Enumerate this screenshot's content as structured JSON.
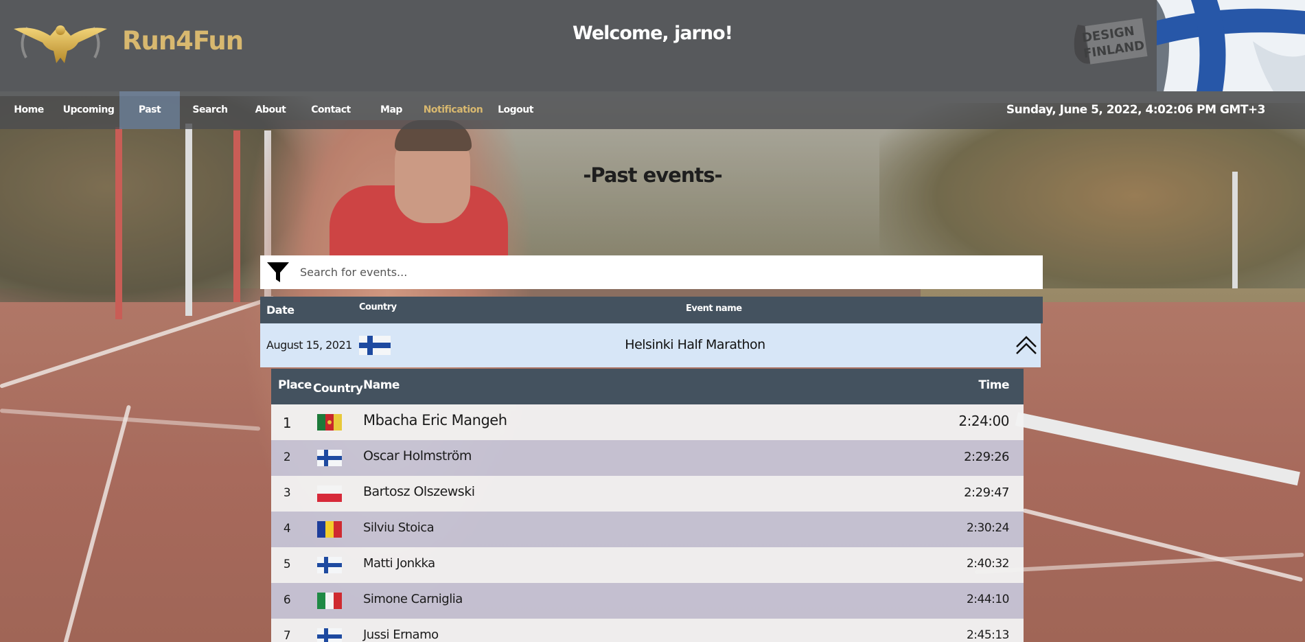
{
  "header": {
    "brand": "Run4Fun",
    "welcome": "Welcome, jarno!",
    "badge_line1": "DESIGN",
    "badge_line2": "FINLAND"
  },
  "nav": {
    "items": [
      {
        "label": "Home"
      },
      {
        "label": "Upcoming"
      },
      {
        "label": "Past"
      },
      {
        "label": "Search"
      },
      {
        "label": "About"
      },
      {
        "label": "Contact"
      },
      {
        "label": "Map"
      },
      {
        "label": "Notification"
      },
      {
        "label": "Logout"
      }
    ],
    "active": "Past",
    "datetime": "Sunday, June 5, 2022, 4:02:06 PM GMT+3"
  },
  "page": {
    "title": "-Past events-"
  },
  "search": {
    "placeholder": "Search for events..."
  },
  "events_table": {
    "headers": {
      "date": "Date",
      "country": "Country",
      "event_name": "Event name"
    },
    "event": {
      "date": "August 15, 2021",
      "country_flag": "finland-flag",
      "name": "Helsinki Half Marathon"
    }
  },
  "results": {
    "headers": {
      "place": "Place",
      "country": "Country",
      "name": "Name",
      "time": "Time"
    },
    "rows": [
      {
        "place": "1",
        "flag": "cameroon-flag",
        "name": "Mbacha Eric Mangeh",
        "time": "2:24:00"
      },
      {
        "place": "2",
        "flag": "finland-flag",
        "name": "Oscar Holmström",
        "time": "2:29:26"
      },
      {
        "place": "3",
        "flag": "poland-flag",
        "name": "Bartosz Olszewski",
        "time": "2:29:47"
      },
      {
        "place": "4",
        "flag": "romania-flag",
        "name": "Silviu Stoica",
        "time": "2:30:24"
      },
      {
        "place": "5",
        "flag": "finland-flag",
        "name": "Matti Jonkka",
        "time": "2:40:32"
      },
      {
        "place": "6",
        "flag": "italy-flag",
        "name": "Simone Carniglia",
        "time": "2:44:10"
      },
      {
        "place": "7",
        "flag": "finland-flag",
        "name": "Jussi Ernamo",
        "time": "2:45:13"
      }
    ]
  },
  "colors": {
    "header_bg": "#57595c",
    "brand_gold": "#d8b86f",
    "table_header": "#44525f",
    "event_row": "#d7e6f7"
  }
}
